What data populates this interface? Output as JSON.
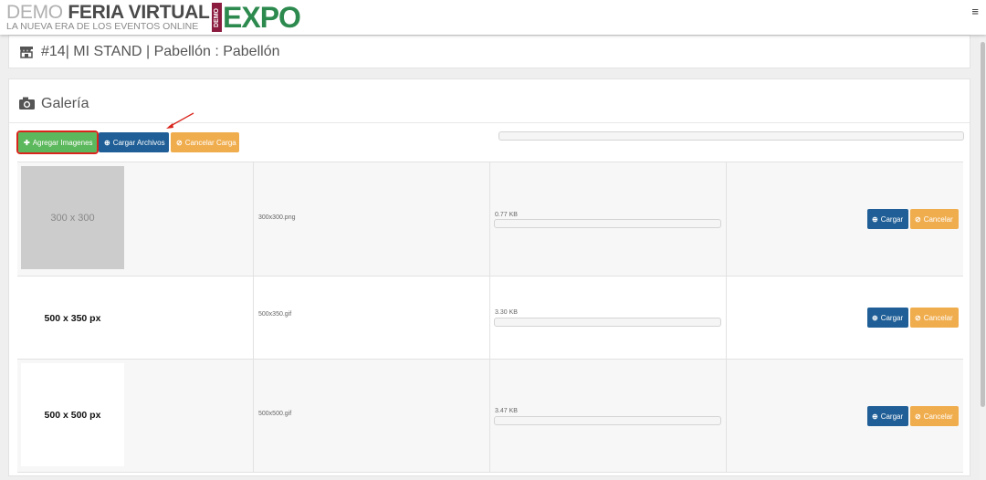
{
  "brand": {
    "demo": "DEMO",
    "feria": "FERIA VIRTUAL",
    "tagline": "LA NUEVA ERA DE LOS EVENTOS ONLINE",
    "logo_demo": "DEMO",
    "logo_expo": "EXPO"
  },
  "header": {
    "title": "#14| MI STAND | Pabellón : Pabellón",
    "icon": "store-icon"
  },
  "gallery": {
    "title": "Galería",
    "icon": "camera-icon",
    "buttons": {
      "add": "Agregar Imagenes",
      "load_all": "Cargar Archivos",
      "cancel_all": "Cancelar Carga"
    },
    "global_progress": 0,
    "files": [
      {
        "thumb_label": "300 x 300",
        "name": "300x300.png",
        "size": "0.77 KB",
        "progress": 0,
        "load": "Cargar",
        "cancel": "Cancelar"
      },
      {
        "thumb_label": "500 x 350 px",
        "name": "500x350.gif",
        "size": "3.30 KB",
        "progress": 0,
        "load": "Cargar",
        "cancel": "Cancelar"
      },
      {
        "thumb_label": "500 x 500 px",
        "name": "500x500.gif",
        "size": "3.47 KB",
        "progress": 0,
        "load": "Cargar",
        "cancel": "Cancelar"
      }
    ]
  },
  "colors": {
    "green": "#5cb85c",
    "blue": "#1f5e96",
    "orange": "#f0ad4e",
    "highlight_red": "#d9251c",
    "expo_green": "#2d8a4e",
    "demo_maroon": "#8b1c3f"
  }
}
